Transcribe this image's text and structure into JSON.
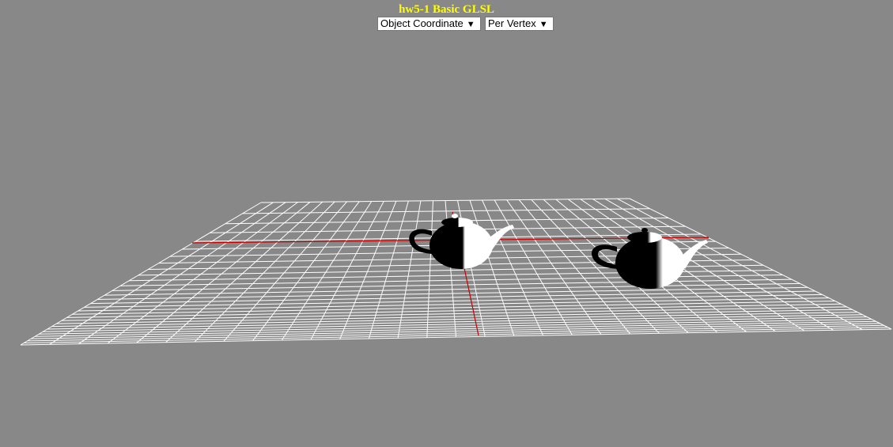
{
  "title": "hw5-1 Basic GLSL",
  "controls": {
    "coordinate_select": {
      "value": "Object Coordinate",
      "arrow": "▼"
    },
    "shading_select": {
      "value": "Per Vertex",
      "arrow": "▼"
    }
  },
  "colors": {
    "background": "#888888",
    "title": "#ffff00",
    "grid": "#ffffff",
    "axis": "#cc0000",
    "teapot_dark": "#000000",
    "teapot_light": "#ffffff"
  }
}
